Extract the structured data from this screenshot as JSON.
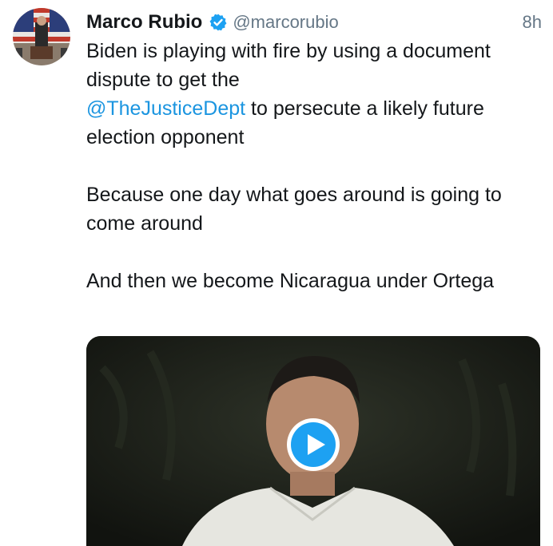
{
  "tweet": {
    "display_name": "Marco Rubio",
    "handle": "@marcorubio",
    "time": "8h",
    "verified_icon": "verified-badge-icon",
    "text": {
      "line1": "Biden is playing with fire by using a document dispute to get the",
      "mention": "@TheJusticeDept",
      "line1_rest": " to persecute a likely future election opponent",
      "para2": "Because one day what goes around is going to come around",
      "para3": "And then we become Nicaragua under Ortega"
    },
    "media": {
      "type": "video",
      "play_icon": "play-icon"
    }
  },
  "colors": {
    "link": "#1b95e0",
    "text": "#14171a",
    "secondary": "#657786",
    "verified": "#1da1f2"
  }
}
